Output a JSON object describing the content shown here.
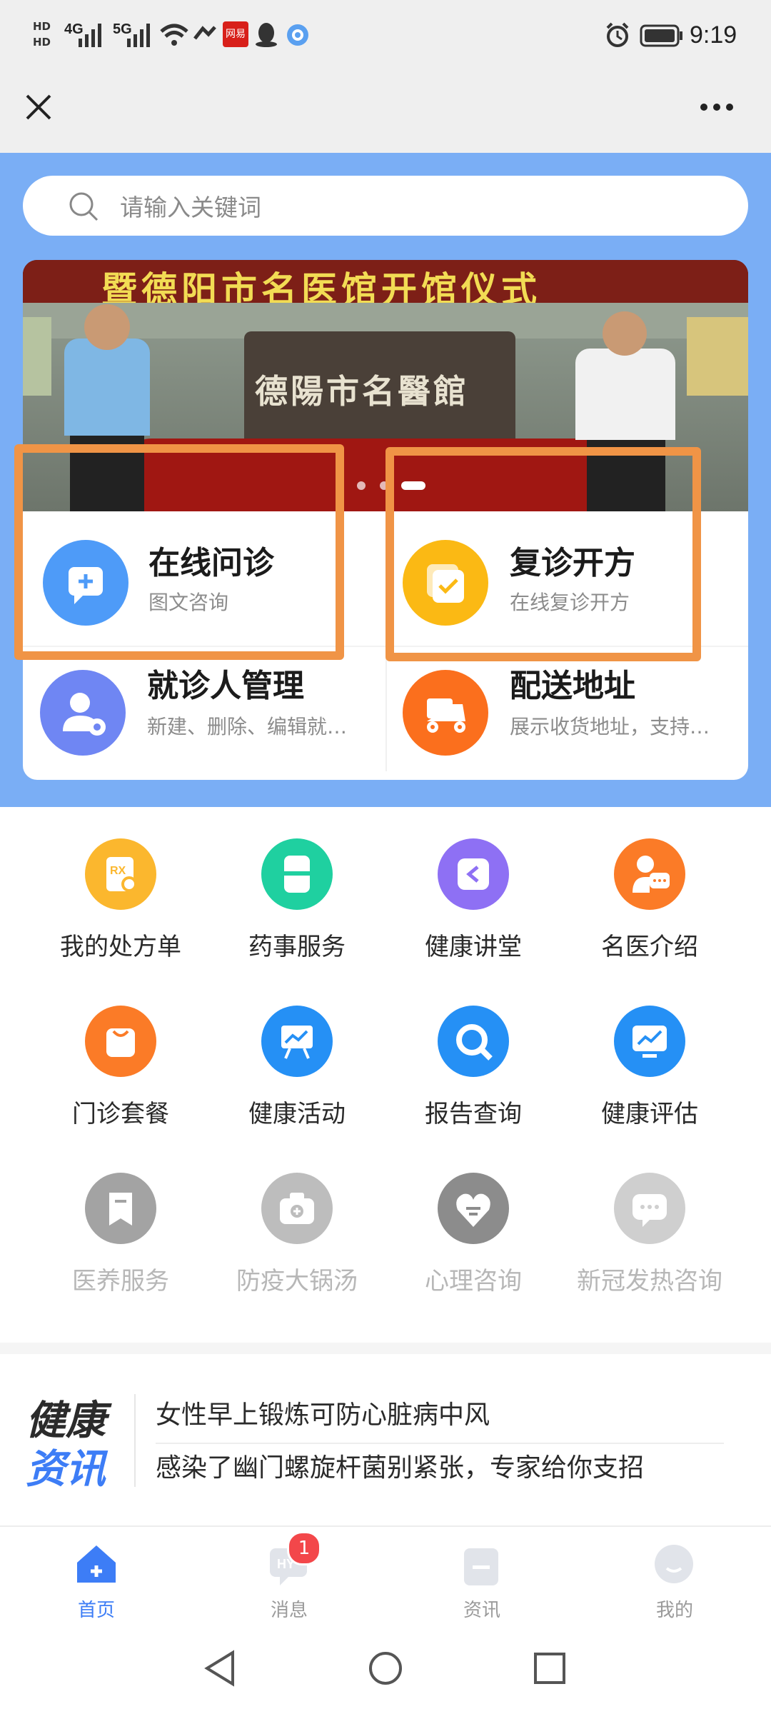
{
  "status_bar": {
    "network_1": "4G",
    "network_2": "5G",
    "time": "9:19",
    "app_badge": "网易"
  },
  "nav": {
    "close_icon": "close-icon",
    "more_icon": "more-icon"
  },
  "search": {
    "placeholder": "请输入关键词"
  },
  "banner": {
    "headline": "暨德阳市名医馆开馆仪式",
    "plaque": "德陽市名醫館",
    "slide_count": 3,
    "active_slide": 3
  },
  "service_cards": [
    {
      "title": "在线问诊",
      "subtitle": "图文咨询",
      "icon": "chat-plus-icon",
      "color": "#4e9bf8",
      "highlighted": true
    },
    {
      "title": "复诊开方",
      "subtitle": "在线复诊开方",
      "icon": "prescription-check-icon",
      "color": "#fbb914",
      "highlighted": true
    },
    {
      "title": "就诊人管理",
      "subtitle": "新建、删除、编辑就诊人",
      "icon": "patient-settings-icon",
      "color": "#6f86f3",
      "highlighted": false
    },
    {
      "title": "配送地址",
      "subtitle": "展示收货地址，支持修改",
      "icon": "delivery-scooter-icon",
      "color": "#fb6f1d",
      "highlighted": false
    }
  ],
  "grid": [
    {
      "label": "我的处方单",
      "icon": "rx-search-icon",
      "color": "#fbb72e",
      "enabled": true
    },
    {
      "label": "药事服务",
      "icon": "pill-box-icon",
      "color": "#1fd0a0",
      "enabled": true
    },
    {
      "label": "健康讲堂",
      "icon": "video-play-icon",
      "color": "#8e70f4",
      "enabled": true
    },
    {
      "label": "名医介绍",
      "icon": "doctor-chat-icon",
      "color": "#fb7b27",
      "enabled": true
    },
    {
      "label": "门诊套餐",
      "icon": "shopping-bag-icon",
      "color": "#fb7b27",
      "enabled": true
    },
    {
      "label": "健康活动",
      "icon": "activity-board-icon",
      "color": "#2590f5",
      "enabled": true
    },
    {
      "label": "报告查询",
      "icon": "magnifier-icon",
      "color": "#2590f5",
      "enabled": true
    },
    {
      "label": "健康评估",
      "icon": "chart-monitor-icon",
      "color": "#2590f5",
      "enabled": true
    },
    {
      "label": "医养服务",
      "icon": "bookmark-icon",
      "color": "#a3a3a3",
      "enabled": false
    },
    {
      "label": "防疫大锅汤",
      "icon": "medical-kit-icon",
      "color": "#bdbdbd",
      "enabled": false
    },
    {
      "label": "心理咨询",
      "icon": "heart-chat-icon",
      "color": "#8c8c8c",
      "enabled": false
    },
    {
      "label": "新冠发热咨询",
      "icon": "chat-dots-icon",
      "color": "#cfcfcf",
      "enabled": false
    }
  ],
  "news": {
    "logo_line1": "健康",
    "logo_line2": "资讯",
    "items": [
      "女性早上锻炼可防心脏病中风",
      "感染了幽门螺旋杆菌别紧张，专家给你支招"
    ]
  },
  "tabs": [
    {
      "label": "首页",
      "icon": "home-icon",
      "active": true
    },
    {
      "label": "消息",
      "icon": "message-icon",
      "active": false,
      "badge": "1"
    },
    {
      "label": "资讯",
      "icon": "news-icon",
      "active": false
    },
    {
      "label": "我的",
      "icon": "profile-icon",
      "active": false
    }
  ],
  "colors": {
    "accent": "#3d7df6",
    "header_bg": "#7aaef5",
    "highlight": "#f09446"
  }
}
